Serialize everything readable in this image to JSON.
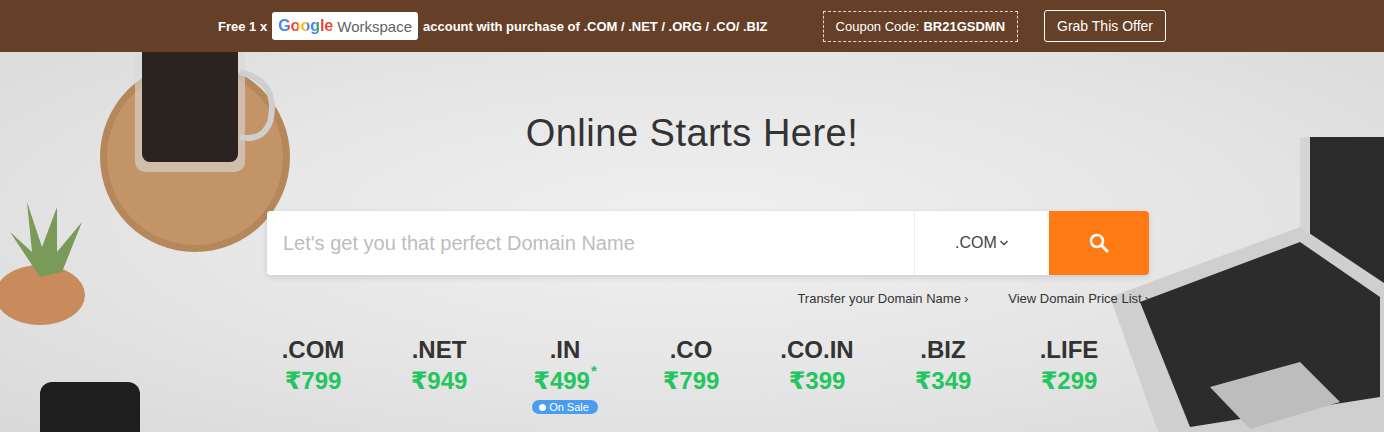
{
  "promo": {
    "prefix": "Free 1 x",
    "logo": {
      "brand": "Google",
      "product": "Workspace"
    },
    "suffix": "account with purchase of .COM / .NET / .ORG / .CO/ .BIZ",
    "coupon": {
      "label": "Coupon Code:",
      "code": "BR21GSDMN"
    },
    "cta": "Grab This Offer"
  },
  "hero": {
    "title": "Online Starts Here!"
  },
  "search": {
    "placeholder": "Let's get you that perfect Domain Name",
    "tld": ".COM"
  },
  "links": [
    {
      "label": "Transfer your Domain Name",
      "arrow": "›"
    },
    {
      "label": "View Domain Price List",
      "arrow": "›"
    }
  ],
  "prices": [
    {
      "tld": ".COM",
      "price": "₹799",
      "on_sale": false
    },
    {
      "tld": ".NET",
      "price": "₹949",
      "on_sale": false
    },
    {
      "tld": ".IN",
      "price": "₹499",
      "note": "*",
      "on_sale": true,
      "badge": "On Sale"
    },
    {
      "tld": ".CO",
      "price": "₹799",
      "on_sale": false
    },
    {
      "tld": ".CO.IN",
      "price": "₹399",
      "on_sale": false
    },
    {
      "tld": ".BIZ",
      "price": "₹349",
      "on_sale": false
    },
    {
      "tld": ".LIFE",
      "price": "₹299",
      "on_sale": false
    }
  ]
}
